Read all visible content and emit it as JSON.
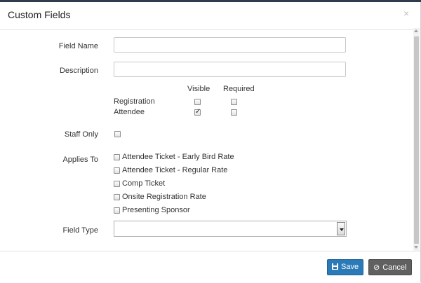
{
  "dialog": {
    "title": "Custom Fields",
    "close_glyph": "×"
  },
  "form": {
    "field_name": {
      "label": "Field Name",
      "value": "",
      "placeholder": ""
    },
    "description": {
      "label": "Description",
      "value": "",
      "placeholder": ""
    },
    "visibility": {
      "columns": [
        "Visible",
        "Required"
      ],
      "rows": [
        {
          "label": "Registration",
          "visible": false,
          "required": false
        },
        {
          "label": "Attendee",
          "visible": true,
          "required": false
        }
      ]
    },
    "staff_only": {
      "label": "Staff Only",
      "checked": false
    },
    "applies_to": {
      "label": "Applies To",
      "items": [
        {
          "label": "Attendee Ticket - Early Bird Rate",
          "checked": false
        },
        {
          "label": "Attendee Ticket - Regular Rate",
          "checked": false
        },
        {
          "label": "Comp Ticket",
          "checked": false
        },
        {
          "label": "Onsite Registration Rate",
          "checked": false
        },
        {
          "label": "Presenting Sponsor",
          "checked": false
        }
      ]
    },
    "field_type": {
      "label": "Field Type",
      "value": ""
    }
  },
  "footer": {
    "save_label": "Save",
    "cancel_label": "Cancel",
    "save_icon": "floppy-disk-icon",
    "cancel_icon": "ban-icon"
  },
  "colors": {
    "save_button": "#2a7ab8",
    "cancel_button": "#606060"
  }
}
